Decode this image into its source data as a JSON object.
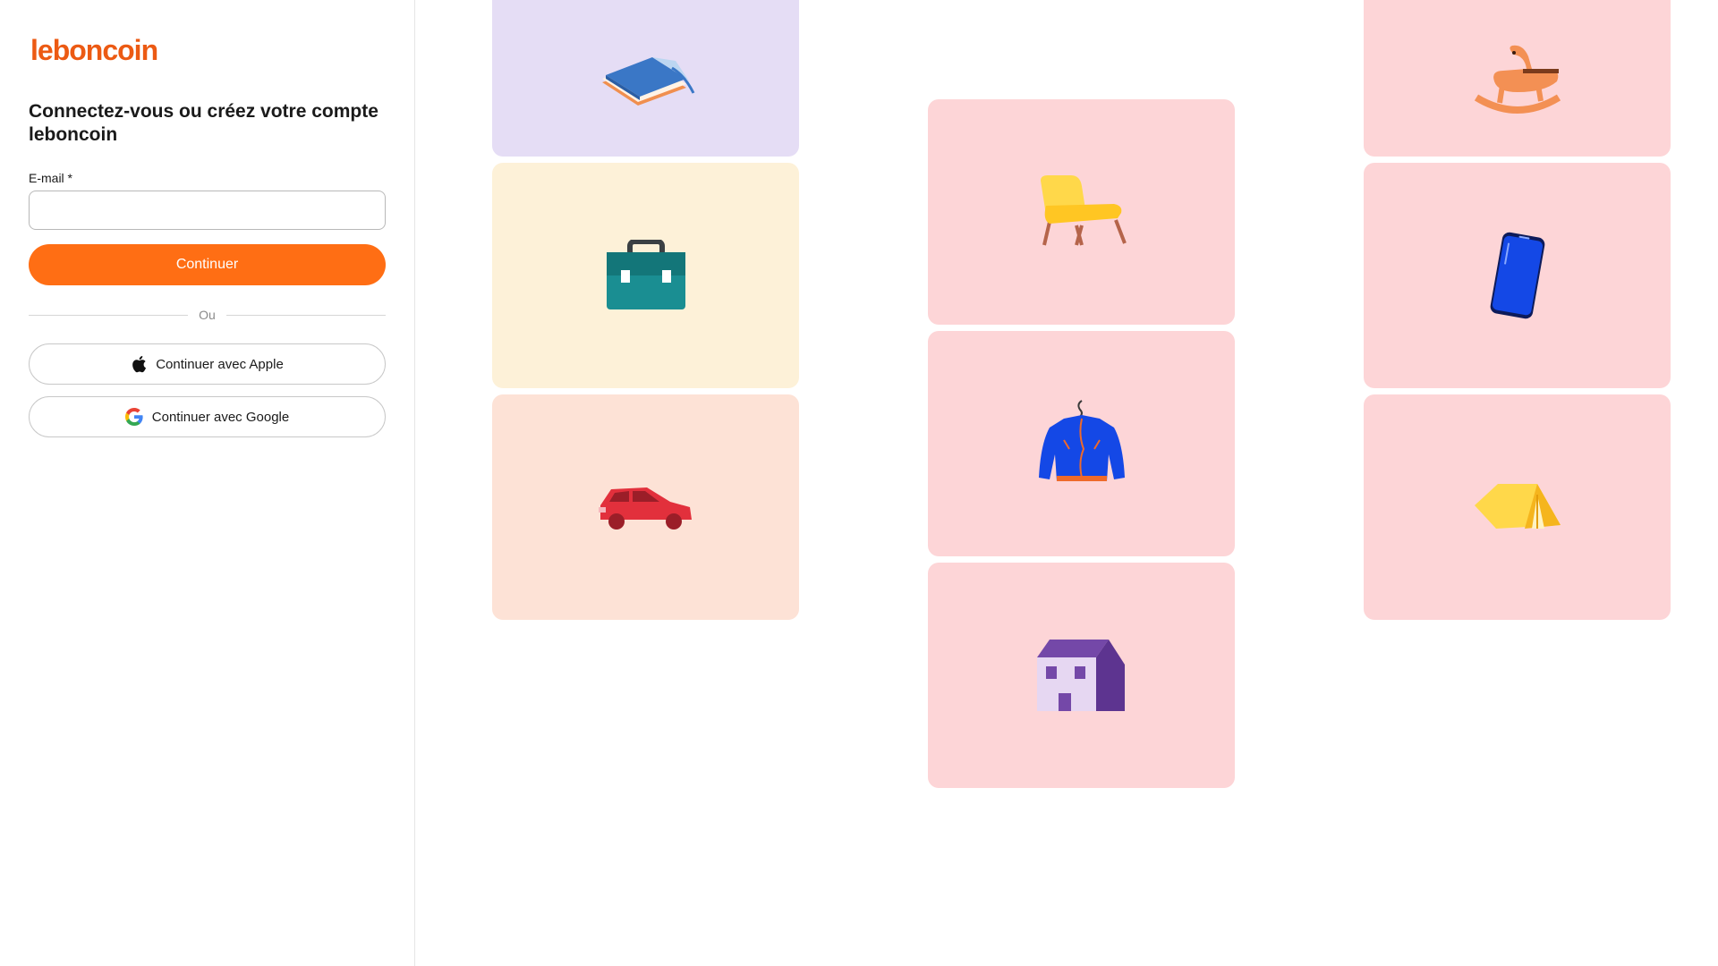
{
  "brand": {
    "logo_text": "leboncoin",
    "accent_color": "#ff6e14"
  },
  "login": {
    "title": "Connectez-vous ou créez votre compte leboncoin",
    "email_label": "E-mail *",
    "email_value": "",
    "email_placeholder": "",
    "continue_label": "Continuer",
    "divider_text": "Ou",
    "apple_label": "Continuer avec Apple",
    "google_label": "Continuer avec Google"
  },
  "gallery": {
    "cards": [
      {
        "icon": "books-icon",
        "background": "#e5ddf5"
      },
      {
        "icon": "briefcase-icon",
        "background": "#fdf1d8"
      },
      {
        "icon": "car-icon",
        "background": "#fde2d6"
      },
      {
        "icon": "armchair-icon",
        "background": "#fdd5d7"
      },
      {
        "icon": "jacket-icon",
        "background": "#fdd5d7"
      },
      {
        "icon": "house-icon",
        "background": "#fdd5d7"
      },
      {
        "icon": "rocking-horse-icon",
        "background": "#fdd5d7"
      },
      {
        "icon": "smartphone-icon",
        "background": "#fdd5d7"
      },
      {
        "icon": "tent-icon",
        "background": "#fdd5d7"
      }
    ]
  }
}
